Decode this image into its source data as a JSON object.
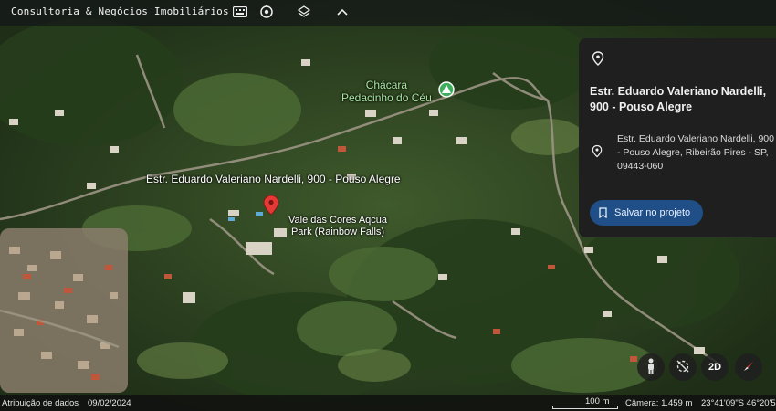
{
  "header": {
    "title": "Consultoria & Negócios Imobiliários",
    "icons": [
      "keyboard-icon",
      "timelapse-icon",
      "layers-icon",
      "chevron-up-icon"
    ]
  },
  "map": {
    "labels": {
      "chacara_line1": "Chácara",
      "chacara_line2": "Pedacinho do Céu",
      "road": "Estr. Eduardo Valeriano Nardelli, 900 - Pouso Alegre",
      "park_line1": "Vale das Cores Aqcua",
      "park_line2": "Park (Rainbow Falls)"
    },
    "colors": {
      "pin": "#e53935",
      "poi": "#3fae5c"
    }
  },
  "panel": {
    "title": "Estr. Eduardo Valeriano Nardelli, 900 - Pouso Alegre",
    "address": "Estr. Eduardo Valeriano Nardelli, 900 - Pouso Alegre, Ribeirão Pires - SP, 09443-060",
    "save_label": "Salvar no projeto"
  },
  "controls": {
    "view_mode": "2D"
  },
  "footer": {
    "attribution": "Atribuição de dados",
    "date": "09/02/2024",
    "scale": "100 m",
    "camera": "Câmera: 1.459 m",
    "coords": "23°41'09\"S 46°20'5"
  }
}
